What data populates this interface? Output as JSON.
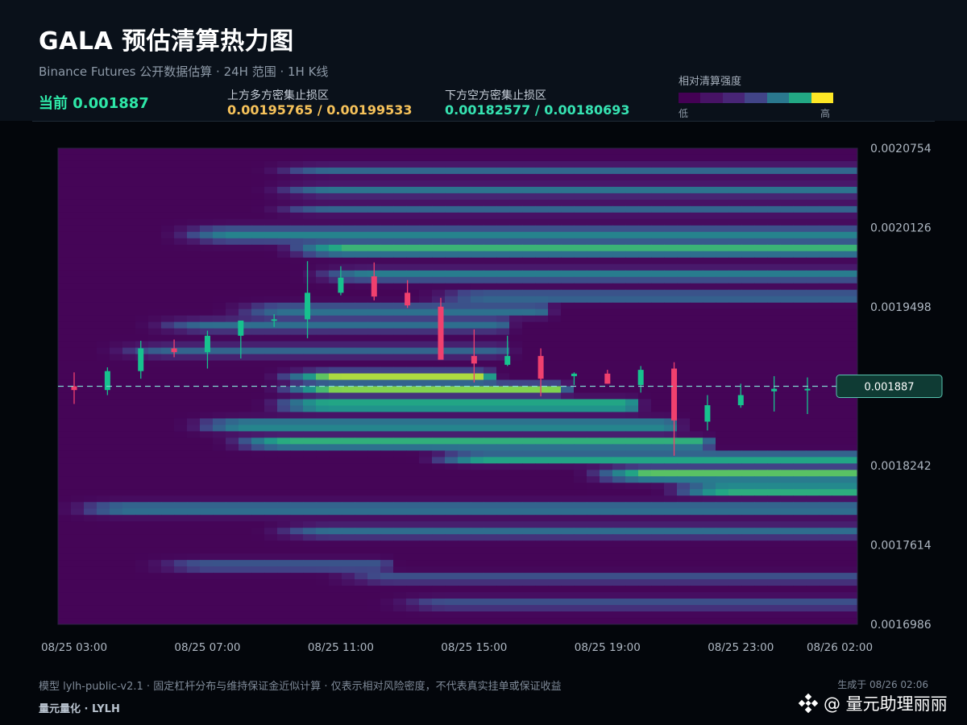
{
  "header": {
    "title": "GALA 预估清算热力图",
    "subtitle": "Binance Futures 公开数据估算 · 24H 范围 · 1H K线",
    "current_label": "当前",
    "current_value": "0.001887",
    "upper_label": "上方多方密集止损区",
    "upper_value": "0.00195765 / 0.00199533",
    "lower_label": "下方空方密集止损区",
    "lower_value": "0.00182577 / 0.00180693"
  },
  "legend": {
    "title": "相对清算强度",
    "low": "低",
    "high": "高",
    "colors": [
      "#440154",
      "#471365",
      "#482576",
      "#414487",
      "#2a788e",
      "#22a884",
      "#fde725"
    ]
  },
  "footer": {
    "note": "模型 lylh-public-v2.1 · 固定杠杆分布与维持保证金近似计算 · 仅表示相对风险密度，不代表真实挂单或保证收益",
    "brand": "量元量化 · LYLH",
    "generated": "生成于 08/26 02:06",
    "watermark": "@ 量元助理丽丽"
  },
  "colors": {
    "up": "#17c28e",
    "down": "#f0406e",
    "price_line": "#7fd8d0",
    "price_badge_bg": "#0f3b34"
  },
  "chart_data": {
    "type": "heatmap",
    "title": "",
    "xlabel": "",
    "ylabel": "",
    "ylim": [
      0.0016986,
      0.0020754
    ],
    "y_ticks": [
      "0.0020754",
      "0.0020126",
      "0.0019498",
      "0.0018870",
      "0.0018242",
      "0.0017614",
      "0.0016986"
    ],
    "y_tick_labels": [
      "0.0020754",
      "0.0020126",
      "0.0019498",
      "",
      "0.0018242",
      "0.0017614",
      "0.0016986"
    ],
    "x_tick_labels": [
      "08/25 03:00",
      "08/25 07:00",
      "08/25 11:00",
      "08/25 15:00",
      "08/25 19:00",
      "08/25 23:00",
      "08/26 02:00"
    ],
    "current_price": 0.001887,
    "current_price_label": "0.001887",
    "candles": [
      {
        "t": "08/25 03:00",
        "o": 0.001887,
        "h": 0.001898,
        "l": 0.001873,
        "c": 0.001884
      },
      {
        "t": "08/25 04:00",
        "o": 0.001884,
        "h": 0.001902,
        "l": 0.00188,
        "c": 0.001899
      },
      {
        "t": "08/25 05:00",
        "o": 0.001899,
        "h": 0.001923,
        "l": 0.001893,
        "c": 0.001917
      },
      {
        "t": "08/25 06:00",
        "o": 0.001917,
        "h": 0.001924,
        "l": 0.00191,
        "c": 0.001914
      },
      {
        "t": "08/25 07:00",
        "o": 0.001914,
        "h": 0.001931,
        "l": 0.001901,
        "c": 0.001927
      },
      {
        "t": "08/25 08:00",
        "o": 0.001927,
        "h": 0.001938,
        "l": 0.001909,
        "c": 0.001939
      },
      {
        "t": "08/25 09:00",
        "o": 0.001939,
        "h": 0.001944,
        "l": 0.001934,
        "c": 0.00194
      },
      {
        "t": "08/25 10:00",
        "o": 0.00194,
        "h": 0.001986,
        "l": 0.001925,
        "c": 0.001961
      },
      {
        "t": "08/25 11:00",
        "o": 0.001961,
        "h": 0.001982,
        "l": 0.001959,
        "c": 0.001973
      },
      {
        "t": "08/25 12:00",
        "o": 0.001974,
        "h": 0.001985,
        "l": 0.001955,
        "c": 0.001958
      },
      {
        "t": "08/25 13:00",
        "o": 0.001961,
        "h": 0.001971,
        "l": 0.001949,
        "c": 0.001951
      },
      {
        "t": "08/25 14:00",
        "o": 0.00195,
        "h": 0.001957,
        "l": 0.001914,
        "c": 0.001908
      },
      {
        "t": "08/25 15:00",
        "o": 0.001911,
        "h": 0.001932,
        "l": 0.00189,
        "c": 0.001905
      },
      {
        "t": "08/25 16:00",
        "o": 0.001904,
        "h": 0.001927,
        "l": 0.001903,
        "c": 0.001911
      },
      {
        "t": "08/25 17:00",
        "o": 0.001911,
        "h": 0.001917,
        "l": 0.001879,
        "c": 0.001893
      },
      {
        "t": "08/25 18:00",
        "o": 0.001895,
        "h": 0.001898,
        "l": 0.001888,
        "c": 0.001897
      },
      {
        "t": "08/25 19:00",
        "o": 0.001897,
        "h": 0.0019,
        "l": 0.001889,
        "c": 0.001889
      },
      {
        "t": "08/25 20:00",
        "o": 0.001888,
        "h": 0.001903,
        "l": 0.001882,
        "c": 0.0019
      },
      {
        "t": "08/25 21:00",
        "o": 0.001901,
        "h": 0.001906,
        "l": 0.001832,
        "c": 0.00186
      },
      {
        "t": "08/25 22:00",
        "o": 0.001859,
        "h": 0.00188,
        "l": 0.001852,
        "c": 0.001872
      },
      {
        "t": "08/25 23:00",
        "o": 0.001872,
        "h": 0.001889,
        "l": 0.00187,
        "c": 0.00188
      },
      {
        "t": "08/26 00:00",
        "o": 0.001883,
        "h": 0.001895,
        "l": 0.001867,
        "c": 0.001885
      },
      {
        "t": "08/26 01:00",
        "o": 0.001885,
        "h": 0.001894,
        "l": 0.001865,
        "c": 0.001885
      }
    ],
    "bands": [
      {
        "price": 0.002058,
        "start": 0.3,
        "end": 1.0,
        "width": 4e-06,
        "peak": 0.42
      },
      {
        "price": 0.002042,
        "start": 0.3,
        "end": 1.0,
        "width": 4.5e-06,
        "peak": 0.48
      },
      {
        "price": 0.002027,
        "start": 0.3,
        "end": 1.0,
        "width": 4e-06,
        "peak": 0.4
      },
      {
        "price": 0.002007,
        "start": 0.18,
        "end": 1.0,
        "width": 6e-06,
        "peak": 0.56
      },
      {
        "price": 0.001995,
        "start": 0.32,
        "end": 1.0,
        "width": 4.5e-06,
        "peak": 0.86
      },
      {
        "price": 0.001975,
        "start": 0.35,
        "end": 1.0,
        "width": 5e-06,
        "peak": 0.55
      },
      {
        "price": 0.001958,
        "start": 0.5,
        "end": 1.0,
        "width": 4e-06,
        "peak": 0.52
      },
      {
        "price": 0.001947,
        "start": 0.25,
        "end": 0.6,
        "width": 5e-06,
        "peak": 0.5
      },
      {
        "price": 0.001935,
        "start": 0.15,
        "end": 0.55,
        "width": 5e-06,
        "peak": 0.45
      },
      {
        "price": 0.001915,
        "start": 0.1,
        "end": 0.55,
        "width": 5e-06,
        "peak": 0.4
      },
      {
        "price": 0.001895,
        "start": 0.31,
        "end": 0.53,
        "width": 4e-06,
        "peak": 0.95
      },
      {
        "price": 0.001885,
        "start": 0.31,
        "end": 0.62,
        "width": 4e-06,
        "peak": 0.92
      },
      {
        "price": 0.001872,
        "start": 0.3,
        "end": 0.71,
        "width": 4.5e-06,
        "peak": 0.96
      },
      {
        "price": 0.001856,
        "start": 0.2,
        "end": 0.76,
        "width": 5e-06,
        "peak": 0.68
      },
      {
        "price": 0.001842,
        "start": 0.25,
        "end": 0.8,
        "width": 4e-06,
        "peak": 0.94
      },
      {
        "price": 0.00183,
        "start": 0.5,
        "end": 1.0,
        "width": 4e-06,
        "peak": 0.86
      },
      {
        "price": 0.001817,
        "start": 0.7,
        "end": 1.0,
        "width": 5e-06,
        "peak": 0.9
      },
      {
        "price": 0.001805,
        "start": 0.8,
        "end": 1.0,
        "width": 4e-06,
        "peak": 1.0
      },
      {
        "price": 0.00179,
        "start": 0.05,
        "end": 1.0,
        "width": 5e-06,
        "peak": 0.55
      },
      {
        "price": 0.001772,
        "start": 0.3,
        "end": 1.0,
        "width": 5e-06,
        "peak": 0.45
      },
      {
        "price": 0.001745,
        "start": 0.15,
        "end": 0.4,
        "width": 4.5e-06,
        "peak": 0.38
      },
      {
        "price": 0.001735,
        "start": 0.38,
        "end": 1.0,
        "width": 4e-06,
        "peak": 0.36
      },
      {
        "price": 0.001715,
        "start": 0.45,
        "end": 1.0,
        "width": 5e-06,
        "peak": 0.32
      }
    ]
  }
}
